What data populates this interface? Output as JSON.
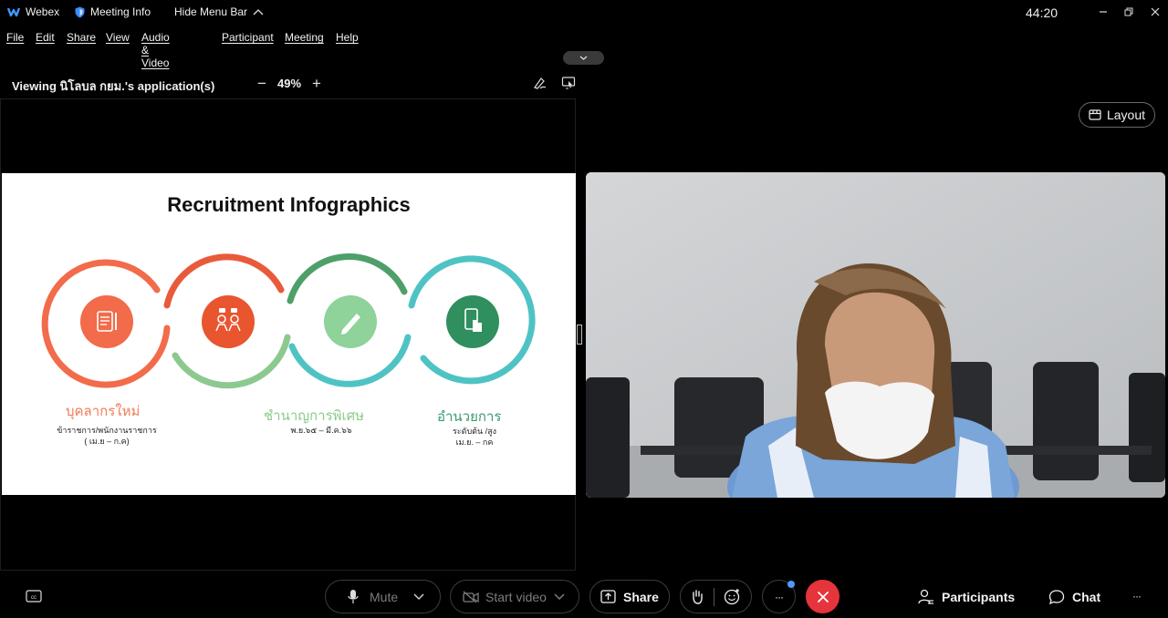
{
  "titlebar": {
    "app_name": "Webex",
    "meeting_info": "Meeting Info",
    "hide_menu": "Hide Menu Bar",
    "timer": "44:20"
  },
  "menu": [
    "File",
    "Edit",
    "Share",
    "View",
    "Audio & Video",
    "Participant",
    "Meeting",
    "Help"
  ],
  "share_header": {
    "viewing_label": "Viewing นิโลบล กยม.'s application(s)",
    "zoom_minus": "−",
    "zoom_level": "49%",
    "zoom_plus": "+"
  },
  "slide": {
    "title": "Recruitment Infographics",
    "stages": [
      {
        "name": "บุคลากรใหม่",
        "sub1": "ข้าราชการ/พนักงานราชการ",
        "sub2": "( เม.ย – ก.ค)",
        "color": "#f07c59"
      },
      {
        "name": "ชำนาญการพิเศษ",
        "sub1": "พ.ย.๖๕ – มี.ค.๖๖",
        "sub2": "",
        "color": "#8ccb8a"
      },
      {
        "name": "อำนวยการ",
        "sub1": "ระดับต้น /สูง",
        "sub2": "เม.ย. – กค",
        "color": "#3a9a6e"
      }
    ],
    "ring_colors": [
      "#f26b4a",
      "#e85a3c",
      "#5fb97b",
      "#4fc3c4"
    ],
    "icon_colors": [
      "#f26b4a",
      "#e8552f",
      "#8fd29a",
      "#2f8f5e"
    ],
    "icons": [
      "document-pencil-icon",
      "people-talk-icon",
      "pencil-icon",
      "phone-touch-icon"
    ]
  },
  "layout_button": "Layout",
  "controls": {
    "mute": "Mute",
    "start_video": "Start video",
    "share": "Share",
    "more": "···",
    "participants": "Participants",
    "chat": "Chat",
    "overflow": "···"
  },
  "colors": {
    "end_call": "#e5343b",
    "notify_dot": "#4c9cff"
  }
}
